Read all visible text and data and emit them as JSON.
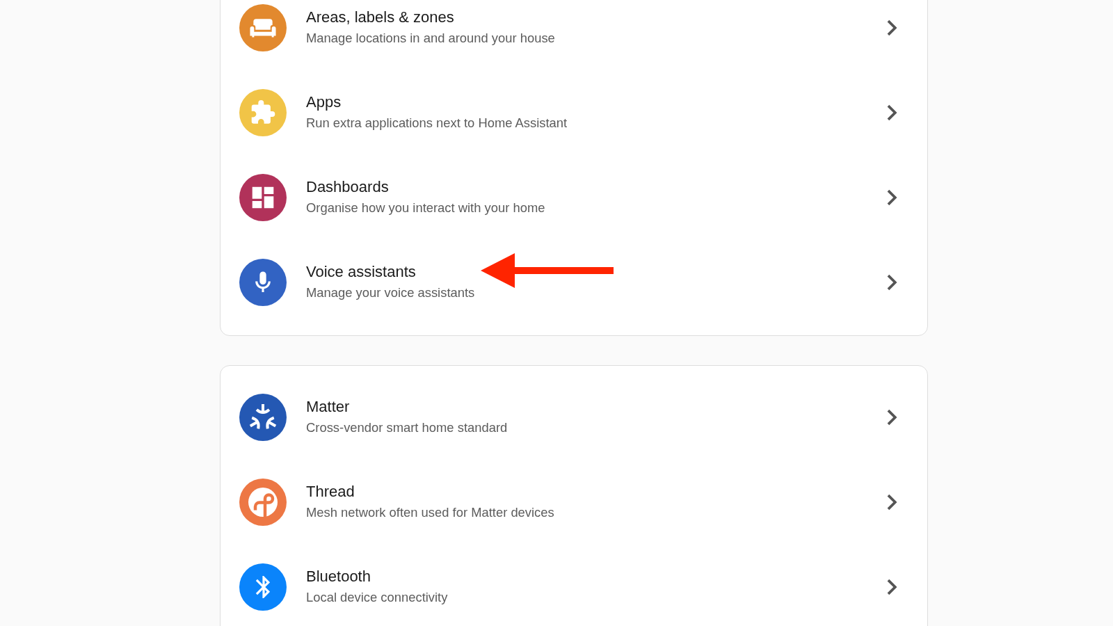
{
  "sections": [
    {
      "items": [
        {
          "title": "Areas, labels & zones",
          "description": "Manage locations in and around your house",
          "color": "#e2892e",
          "annotated": false
        },
        {
          "title": "Apps",
          "description": "Run extra applications next to Home Assistant",
          "color": "#f1c447",
          "annotated": false
        },
        {
          "title": "Dashboards",
          "description": "Organise how you interact with your home",
          "color": "#b1325a",
          "annotated": false
        },
        {
          "title": "Voice assistants",
          "description": "Manage your voice assistants",
          "color": "#3263c3",
          "annotated": true
        }
      ]
    },
    {
      "items": [
        {
          "title": "Matter",
          "description": "Cross-vendor smart home standard",
          "color": "#2458b3",
          "annotated": false
        },
        {
          "title": "Thread",
          "description": "Mesh network often used for Matter devices",
          "color": "#ed7744",
          "annotated": false
        },
        {
          "title": "Bluetooth",
          "description": "Local device connectivity",
          "color": "#0a84fb",
          "annotated": false
        }
      ]
    }
  ]
}
